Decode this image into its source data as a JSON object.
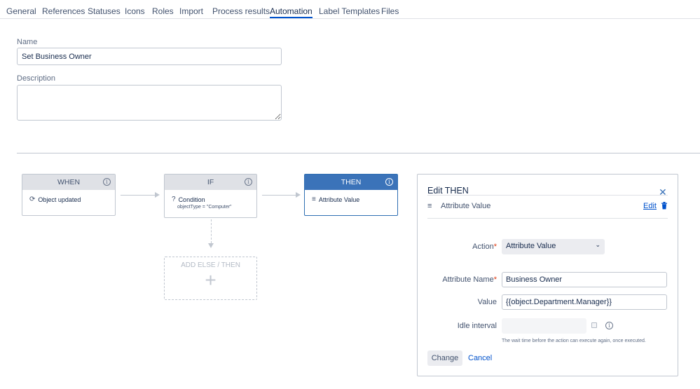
{
  "tabs": [
    {
      "label": "General"
    },
    {
      "label": "References"
    },
    {
      "label": "Statuses"
    },
    {
      "label": "Icons"
    },
    {
      "label": "Roles"
    },
    {
      "label": "Import"
    },
    {
      "label": "Process results"
    },
    {
      "label": "Automation",
      "active": true
    },
    {
      "label": "Label Templates"
    },
    {
      "label": "Files"
    }
  ],
  "form": {
    "name_label": "Name",
    "name_value": "Set Business Owner",
    "description_label": "Description",
    "description_value": ""
  },
  "flow": {
    "when": {
      "title": "WHEN",
      "item": "Object updated",
      "icon": "refresh-icon"
    },
    "if": {
      "title": "IF",
      "item": "Condition",
      "detail": "objectType = \"Computer\"",
      "icon": "question-circle-icon"
    },
    "then": {
      "title": "THEN",
      "item": "Attribute Value",
      "icon": "list-icon"
    },
    "add_else": {
      "label": "ADD ELSE / THEN",
      "icon": "plus-icon"
    }
  },
  "panel": {
    "title": "Edit THEN",
    "summary_label": "Attribute Value",
    "edit_link": "Edit",
    "action_label": "Action",
    "action_value": "Attribute Value",
    "attribute_name_label": "Attribute Name",
    "attribute_name_value": "Business Owner",
    "value_label": "Value",
    "value_value": "{{object.Department.Manager}}",
    "idle_label": "Idle interval",
    "idle_value": "",
    "hint": "The wait time before the action can execute again, once executed.",
    "change_button": "Change",
    "cancel_link": "Cancel"
  },
  "colors": {
    "accent": "#0052cc",
    "then_header": "#3b73b9",
    "required": "#de350b"
  }
}
